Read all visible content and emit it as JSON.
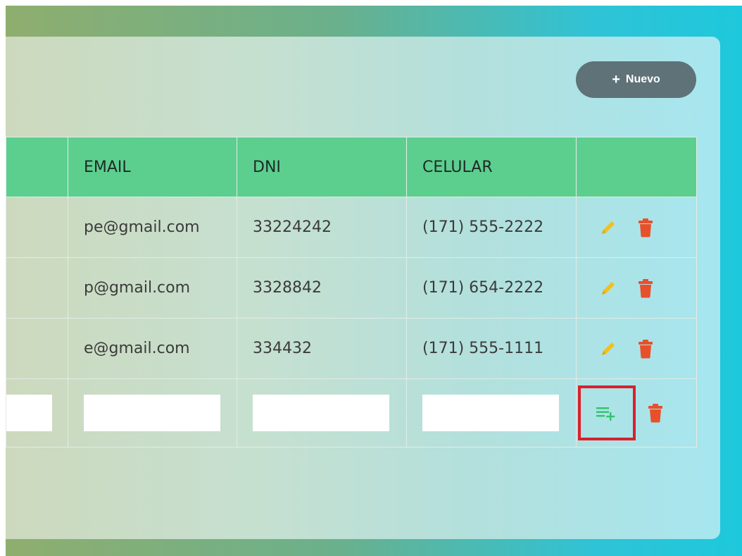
{
  "toolbar": {
    "new_label": "Nuevo"
  },
  "table": {
    "headers": [
      "",
      "EMAIL",
      "DNI",
      "CELULAR",
      ""
    ],
    "rows": [
      {
        "email": "pe@gmail.com",
        "dni": "33224242",
        "celular": "(171) 555-2222"
      },
      {
        "email": "p@gmail.com",
        "dni": "3328842",
        "celular": "(171) 654-2222"
      },
      {
        "email": "e@gmail.com",
        "dni": "334432",
        "celular": "(171) 555-1111"
      }
    ],
    "edit_row": {
      "first": "",
      "email": "",
      "dni": "",
      "celular": ""
    }
  },
  "colors": {
    "header_bg": "#5ccf8f",
    "button_bg": "#5e7278",
    "edit_icon": "#f2c01e",
    "delete_icon": "#e8502b",
    "save_icon": "#33c26a",
    "highlight_border": "#d9212c"
  },
  "icons": {
    "new": "plus-icon",
    "edit": "pencil-icon",
    "delete": "trash-icon",
    "save": "playlist-add-icon"
  }
}
